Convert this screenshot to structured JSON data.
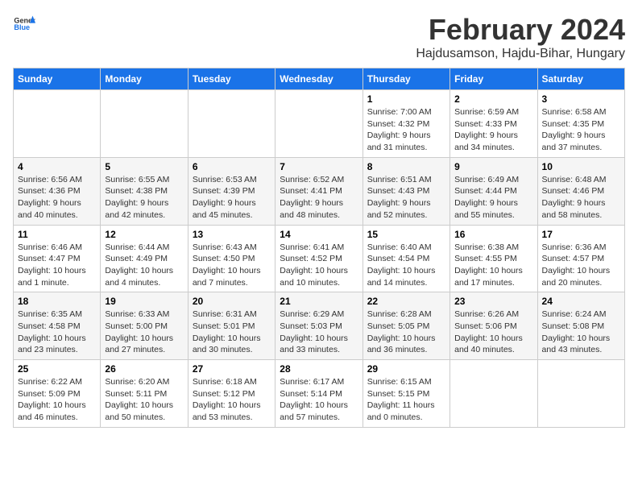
{
  "header": {
    "logo_general": "General",
    "logo_blue": "Blue",
    "title": "February 2024",
    "subtitle": "Hajdusamson, Hajdu-Bihar, Hungary"
  },
  "weekdays": [
    "Sunday",
    "Monday",
    "Tuesday",
    "Wednesday",
    "Thursday",
    "Friday",
    "Saturday"
  ],
  "weeks": [
    [
      {
        "day": "",
        "info": ""
      },
      {
        "day": "",
        "info": ""
      },
      {
        "day": "",
        "info": ""
      },
      {
        "day": "",
        "info": ""
      },
      {
        "day": "1",
        "info": "Sunrise: 7:00 AM\nSunset: 4:32 PM\nDaylight: 9 hours\nand 31 minutes."
      },
      {
        "day": "2",
        "info": "Sunrise: 6:59 AM\nSunset: 4:33 PM\nDaylight: 9 hours\nand 34 minutes."
      },
      {
        "day": "3",
        "info": "Sunrise: 6:58 AM\nSunset: 4:35 PM\nDaylight: 9 hours\nand 37 minutes."
      }
    ],
    [
      {
        "day": "4",
        "info": "Sunrise: 6:56 AM\nSunset: 4:36 PM\nDaylight: 9 hours\nand 40 minutes."
      },
      {
        "day": "5",
        "info": "Sunrise: 6:55 AM\nSunset: 4:38 PM\nDaylight: 9 hours\nand 42 minutes."
      },
      {
        "day": "6",
        "info": "Sunrise: 6:53 AM\nSunset: 4:39 PM\nDaylight: 9 hours\nand 45 minutes."
      },
      {
        "day": "7",
        "info": "Sunrise: 6:52 AM\nSunset: 4:41 PM\nDaylight: 9 hours\nand 48 minutes."
      },
      {
        "day": "8",
        "info": "Sunrise: 6:51 AM\nSunset: 4:43 PM\nDaylight: 9 hours\nand 52 minutes."
      },
      {
        "day": "9",
        "info": "Sunrise: 6:49 AM\nSunset: 4:44 PM\nDaylight: 9 hours\nand 55 minutes."
      },
      {
        "day": "10",
        "info": "Sunrise: 6:48 AM\nSunset: 4:46 PM\nDaylight: 9 hours\nand 58 minutes."
      }
    ],
    [
      {
        "day": "11",
        "info": "Sunrise: 6:46 AM\nSunset: 4:47 PM\nDaylight: 10 hours\nand 1 minute."
      },
      {
        "day": "12",
        "info": "Sunrise: 6:44 AM\nSunset: 4:49 PM\nDaylight: 10 hours\nand 4 minutes."
      },
      {
        "day": "13",
        "info": "Sunrise: 6:43 AM\nSunset: 4:50 PM\nDaylight: 10 hours\nand 7 minutes."
      },
      {
        "day": "14",
        "info": "Sunrise: 6:41 AM\nSunset: 4:52 PM\nDaylight: 10 hours\nand 10 minutes."
      },
      {
        "day": "15",
        "info": "Sunrise: 6:40 AM\nSunset: 4:54 PM\nDaylight: 10 hours\nand 14 minutes."
      },
      {
        "day": "16",
        "info": "Sunrise: 6:38 AM\nSunset: 4:55 PM\nDaylight: 10 hours\nand 17 minutes."
      },
      {
        "day": "17",
        "info": "Sunrise: 6:36 AM\nSunset: 4:57 PM\nDaylight: 10 hours\nand 20 minutes."
      }
    ],
    [
      {
        "day": "18",
        "info": "Sunrise: 6:35 AM\nSunset: 4:58 PM\nDaylight: 10 hours\nand 23 minutes."
      },
      {
        "day": "19",
        "info": "Sunrise: 6:33 AM\nSunset: 5:00 PM\nDaylight: 10 hours\nand 27 minutes."
      },
      {
        "day": "20",
        "info": "Sunrise: 6:31 AM\nSunset: 5:01 PM\nDaylight: 10 hours\nand 30 minutes."
      },
      {
        "day": "21",
        "info": "Sunrise: 6:29 AM\nSunset: 5:03 PM\nDaylight: 10 hours\nand 33 minutes."
      },
      {
        "day": "22",
        "info": "Sunrise: 6:28 AM\nSunset: 5:05 PM\nDaylight: 10 hours\nand 36 minutes."
      },
      {
        "day": "23",
        "info": "Sunrise: 6:26 AM\nSunset: 5:06 PM\nDaylight: 10 hours\nand 40 minutes."
      },
      {
        "day": "24",
        "info": "Sunrise: 6:24 AM\nSunset: 5:08 PM\nDaylight: 10 hours\nand 43 minutes."
      }
    ],
    [
      {
        "day": "25",
        "info": "Sunrise: 6:22 AM\nSunset: 5:09 PM\nDaylight: 10 hours\nand 46 minutes."
      },
      {
        "day": "26",
        "info": "Sunrise: 6:20 AM\nSunset: 5:11 PM\nDaylight: 10 hours\nand 50 minutes."
      },
      {
        "day": "27",
        "info": "Sunrise: 6:18 AM\nSunset: 5:12 PM\nDaylight: 10 hours\nand 53 minutes."
      },
      {
        "day": "28",
        "info": "Sunrise: 6:17 AM\nSunset: 5:14 PM\nDaylight: 10 hours\nand 57 minutes."
      },
      {
        "day": "29",
        "info": "Sunrise: 6:15 AM\nSunset: 5:15 PM\nDaylight: 11 hours\nand 0 minutes."
      },
      {
        "day": "",
        "info": ""
      },
      {
        "day": "",
        "info": ""
      }
    ]
  ]
}
